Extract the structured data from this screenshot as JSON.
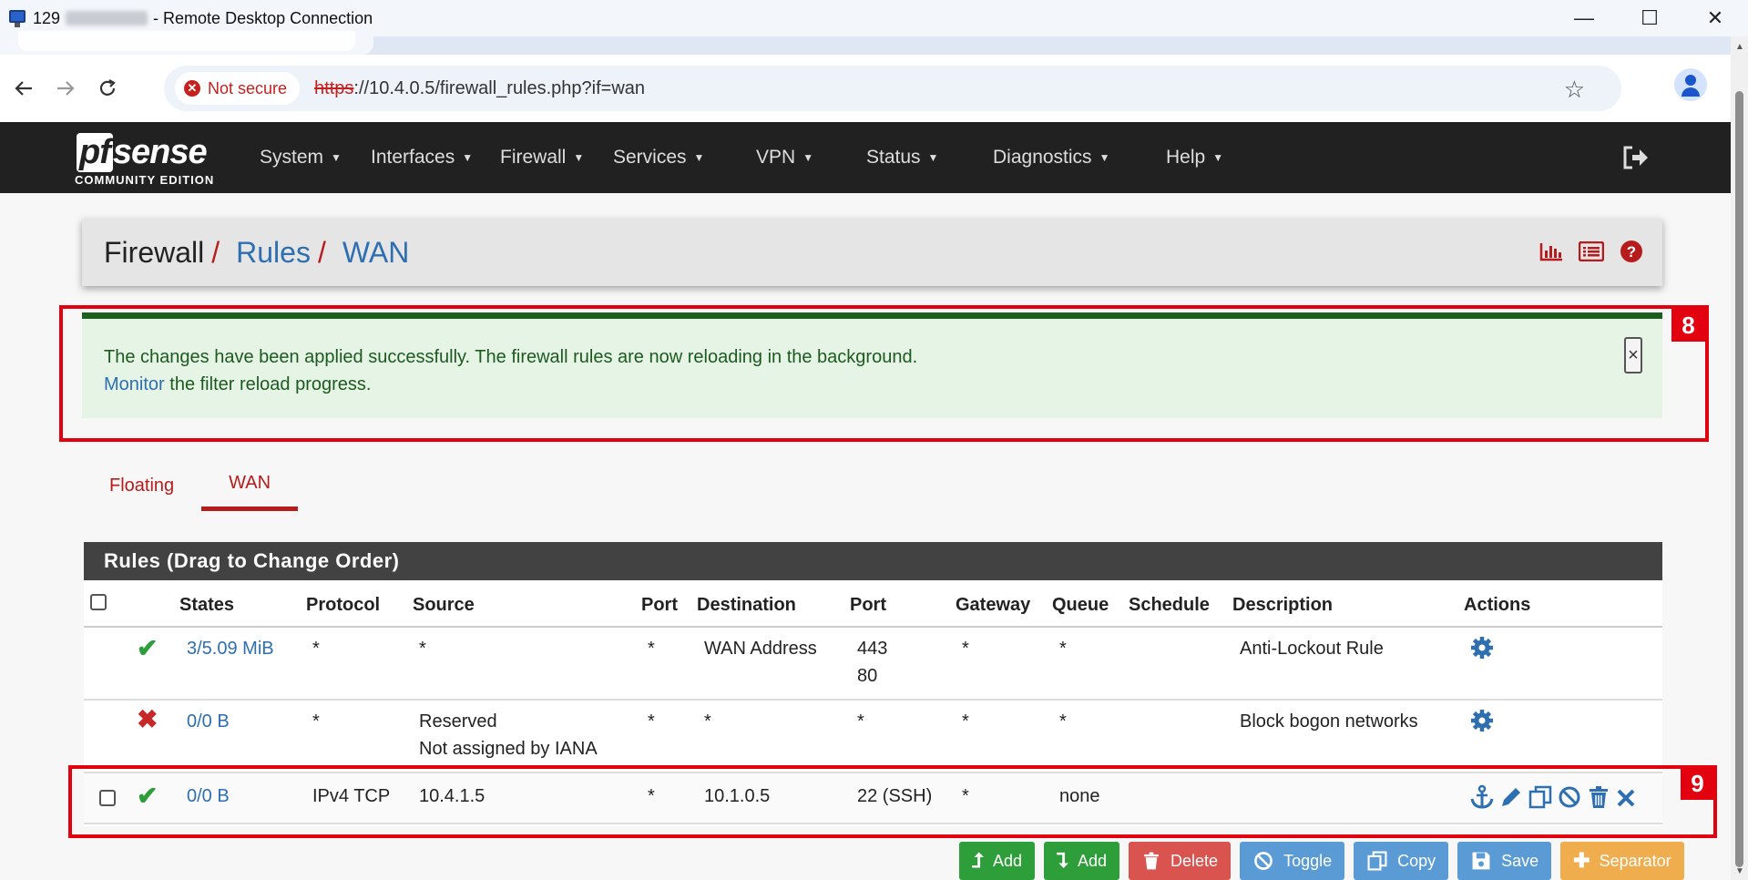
{
  "window": {
    "title_prefix": "129",
    "title_suffix": "- Remote Desktop Connection",
    "minimize": "—",
    "maximize": "☐",
    "close": "✕"
  },
  "browser": {
    "security_label": "Not secure",
    "url_scheme": "https",
    "url_rest": "://10.4.0.5/firewall_rules.php?if=wan"
  },
  "pfsense": {
    "logo_main": "sense",
    "logo_pf": "pf",
    "logo_edition": "COMMUNITY EDITION",
    "menu": [
      "System",
      "Interfaces",
      "Firewall",
      "Services",
      "VPN",
      "Status",
      "Diagnostics",
      "Help"
    ]
  },
  "breadcrumb": {
    "root": "Firewall",
    "sep": "/",
    "level2": "Rules",
    "level3": "WAN"
  },
  "alert": {
    "line1": "The changes have been applied successfully. The firewall rules are now reloading in the background.",
    "link": "Monitor",
    "line2_rest": " the filter reload progress.",
    "close": "×"
  },
  "annotations": {
    "a8": "8",
    "a9": "9"
  },
  "tabs": [
    "Floating",
    "WAN"
  ],
  "rules": {
    "panel_title": "Rules (Drag to Change Order)",
    "headers": {
      "states": "States",
      "protocol": "Protocol",
      "source": "Source",
      "port": "Port",
      "destination": "Destination",
      "dport": "Port",
      "gateway": "Gateway",
      "queue": "Queue",
      "schedule": "Schedule",
      "description": "Description",
      "actions": "Actions"
    },
    "rows": [
      {
        "status": "✔",
        "states": "3/5.09 MiB",
        "protocol": "*",
        "source": "*",
        "source2": "",
        "port": "*",
        "destination": "WAN Address",
        "dport": "443",
        "dport2": "80",
        "gateway": "*",
        "queue": "*",
        "schedule": "",
        "description": "Anti-Lockout Rule"
      },
      {
        "status": "✖",
        "states": "0/0 B",
        "protocol": "*",
        "source": "Reserved",
        "source2": "Not assigned by IANA",
        "port": "*",
        "destination": "*",
        "dport": "*",
        "dport2": "",
        "gateway": "*",
        "queue": "*",
        "schedule": "",
        "description": "Block bogon networks"
      },
      {
        "status": "✔",
        "states": "0/0 B",
        "protocol": "IPv4 TCP",
        "source": "10.4.1.5",
        "source2": "",
        "port": "*",
        "destination": "10.1.0.5",
        "dport": "22 (SSH)",
        "dport2": "",
        "gateway": "*",
        "queue": "none",
        "schedule": "",
        "description": ""
      }
    ]
  },
  "buttons": {
    "add_top": "Add",
    "add_bottom": "Add",
    "delete": "Delete",
    "toggle": "Toggle",
    "copy": "Copy",
    "save": "Save",
    "separator": "Separator"
  },
  "colors": {
    "navbar": "#212121",
    "accent_red": "#b71c1c",
    "link_blue": "#2d6fb0",
    "success_bg": "#e6f4e6",
    "annotation_red": "#e3000f"
  }
}
